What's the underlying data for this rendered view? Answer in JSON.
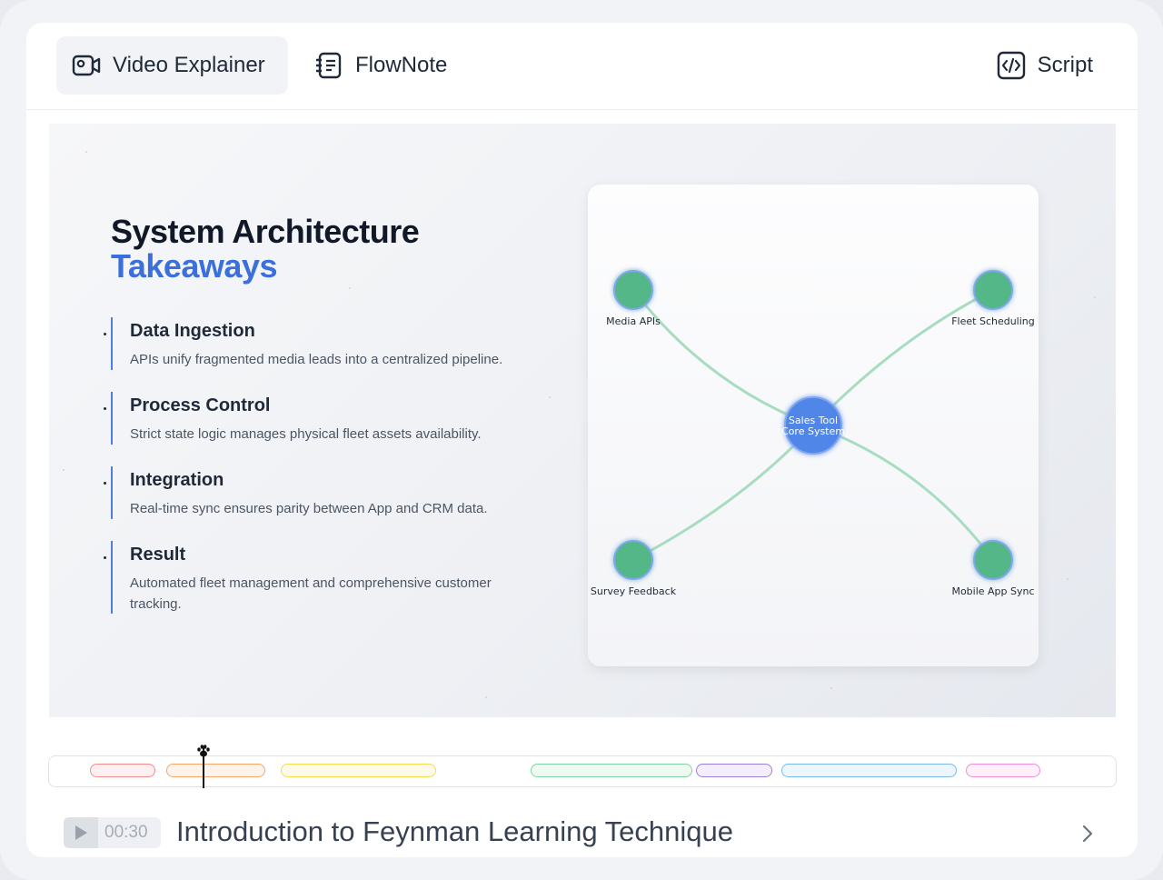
{
  "tabs": {
    "video_explainer": "Video Explainer",
    "flownote": "FlowNote",
    "script": "Script"
  },
  "slide": {
    "title_line1": "System Architecture",
    "title_line2": "Takeaways",
    "takeaways": [
      {
        "heading": "Data Ingestion",
        "text": "APIs unify fragmented media leads into a centralized pipeline."
      },
      {
        "heading": "Process Control",
        "text": "Strict state logic manages physical fleet assets availability."
      },
      {
        "heading": "Integration",
        "text": "Real-time sync ensures parity between App and CRM data."
      },
      {
        "heading": "Result",
        "text": "Automated fleet management and comprehensive customer tracking."
      }
    ]
  },
  "diagram": {
    "center_line1": "Sales Tool",
    "center_line2": "Core System",
    "nodes": [
      "Media APIs",
      "Fleet Scheduling",
      "Survey Feedback",
      "Mobile App Sync"
    ],
    "colors": {
      "center": "#4f86e8",
      "node": "#52b788",
      "edge": "#a8dcc0"
    }
  },
  "timeline": {
    "segment_colors": [
      "#f28b8b",
      "#f3a86a",
      "#f2dc55",
      "#7fd4a0",
      "#9b7fe0",
      "#7bb8e8",
      "#ef8fd8"
    ]
  },
  "player": {
    "time": "00:30",
    "title": "Introduction to Feynman Learning Technique"
  }
}
